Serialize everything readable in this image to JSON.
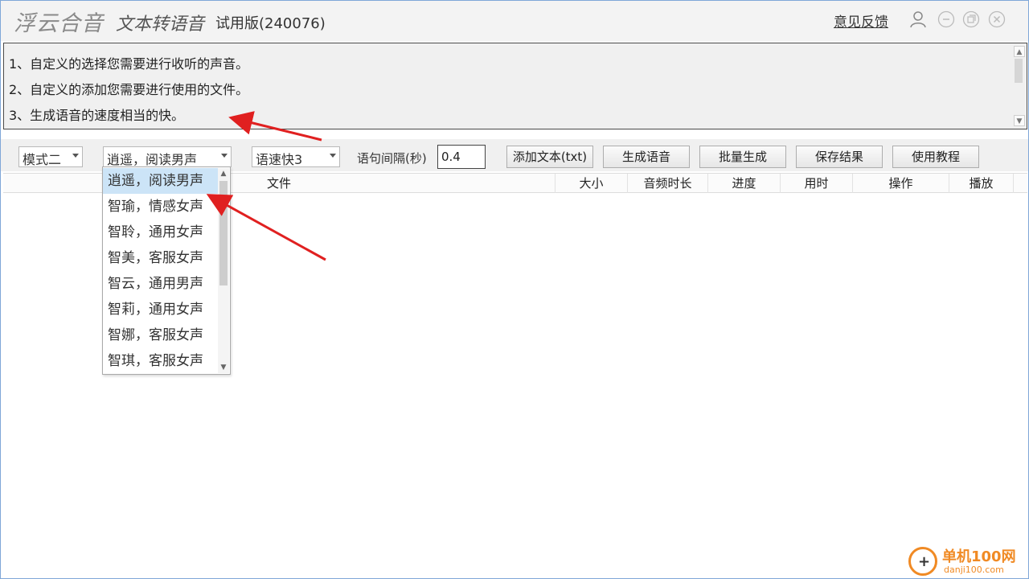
{
  "titlebar": {
    "logo": "浮云合音",
    "subtitle": "文本转语音",
    "version": "试用版(240076)",
    "feedback": "意见反馈"
  },
  "info": {
    "lines": [
      "1、自定义的选择您需要进行收听的声音。",
      "2、自定义的添加您需要进行使用的文件。",
      "3、生成语音的速度相当的快。"
    ]
  },
  "toolbar": {
    "mode": "模式二",
    "voice": "逍遥，阅读男声",
    "speed": "语速快3",
    "interval_label": "语句间隔(秒)",
    "interval_value": "0.4",
    "add_text": "添加文本(txt)",
    "generate": "生成语音",
    "batch": "批量生成",
    "save": "保存结果",
    "tutorial": "使用教程"
  },
  "table": {
    "columns": [
      "文件",
      "大小",
      "音频时长",
      "进度",
      "用时",
      "操作",
      "播放"
    ]
  },
  "dropdown": {
    "items": [
      "逍遥，阅读男声",
      "智瑜，情感女声",
      "智聆，通用女声",
      "智美，客服女声",
      "智云，通用男声",
      "智莉，通用女声",
      "智娜，客服女声",
      "智琪，客服女声"
    ]
  },
  "watermark": {
    "title": "单机100网",
    "url": "danji100.com"
  },
  "colors": {
    "accent_border": "#7fa7d8",
    "selected_bg": "#cce4f7",
    "annotation_arrow": "#e02020",
    "watermark": "#f08a24"
  }
}
